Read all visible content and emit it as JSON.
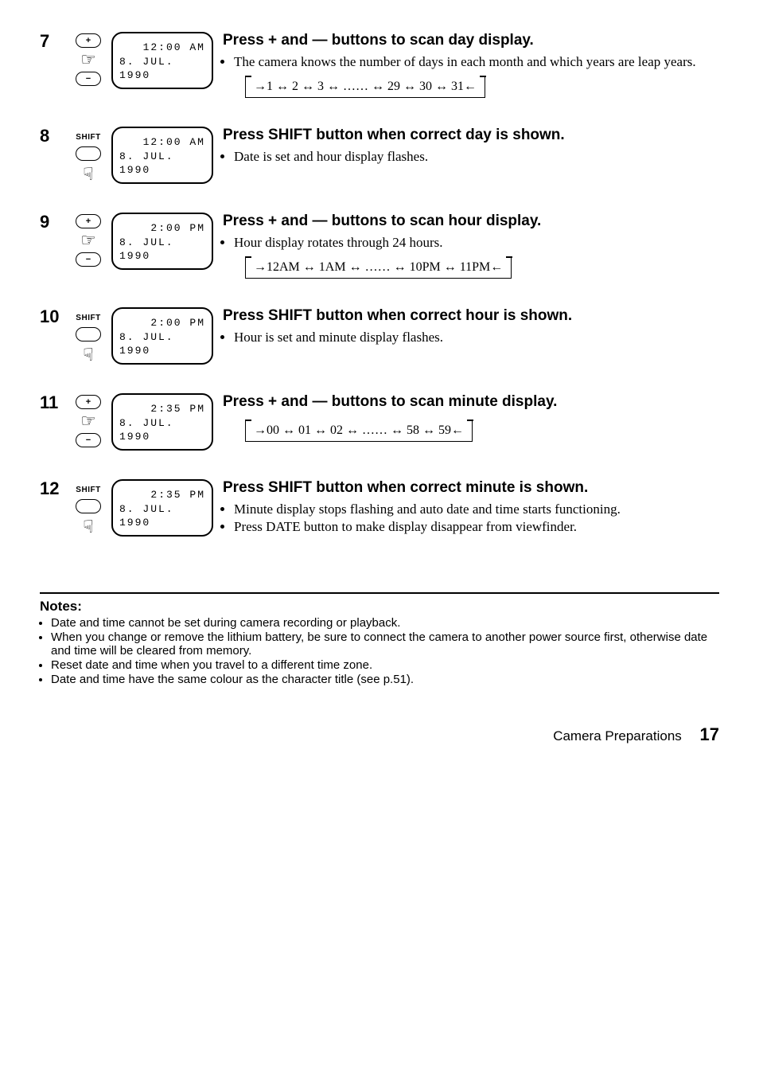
{
  "steps": [
    {
      "num": "7",
      "lcd": {
        "line1": "12:00 AM",
        "line2": "8. JUL. 1990"
      },
      "buttons": "plusminus",
      "title": "Press + and — buttons to scan day display.",
      "bullets": [
        "The camera knows the number of days in each month and which years are leap years."
      ],
      "sequence": "→1 ↔ 2 ↔ 3 ↔ …… ↔ 29 ↔ 30 ↔ 31←"
    },
    {
      "num": "8",
      "lcd": {
        "line1": "12:00 AM",
        "line2": "8. JUL. 1990"
      },
      "buttons": "shift",
      "title": "Press SHIFT button when correct day is shown.",
      "bullets": [
        "Date is set and hour display flashes."
      ]
    },
    {
      "num": "9",
      "lcd": {
        "line1": "2:00 PM",
        "line2": "8. JUL. 1990"
      },
      "buttons": "plusminus",
      "title": "Press + and — buttons to scan hour display.",
      "bullets": [
        "Hour display rotates through 24 hours."
      ],
      "sequence": "→12AM ↔ 1AM ↔ …… ↔ 10PM ↔ 11PM←"
    },
    {
      "num": "10",
      "lcd": {
        "line1": "2:00 PM",
        "line2": "8. JUL. 1990"
      },
      "buttons": "shift",
      "title": "Press SHIFT button when correct hour is shown.",
      "bullets": [
        "Hour is set and minute display flashes."
      ]
    },
    {
      "num": "11",
      "lcd": {
        "line1": "2:35 PM",
        "line2": "8. JUL. 1990"
      },
      "buttons": "plusminus",
      "title": "Press + and — buttons to scan minute display.",
      "sequence": "→00 ↔ 01 ↔ 02 ↔ …… ↔ 58 ↔ 59←"
    },
    {
      "num": "12",
      "lcd": {
        "line1": "2:35 PM",
        "line2": "8. JUL. 1990"
      },
      "buttons": "shift",
      "title": "Press SHIFT button when correct minute is shown.",
      "bullets": [
        "Minute display stops flashing and auto date and time starts functioning.",
        "Press DATE button to make display disappear from viewfinder."
      ]
    }
  ],
  "notes": {
    "title": "Notes:",
    "items": [
      "Date and time cannot be set during camera recording or playback.",
      "When you change or remove the lithium battery, be sure to connect the camera to another power source first, otherwise date and time will be cleared from memory.",
      "Reset date and time when you travel to a different time zone.",
      "Date and time have the same colour as the character title (see p.51)."
    ]
  },
  "footer": {
    "section": "Camera Preparations",
    "page": "17"
  },
  "labels": {
    "shift": "SHIFT",
    "plus": "+",
    "minus": "−"
  }
}
